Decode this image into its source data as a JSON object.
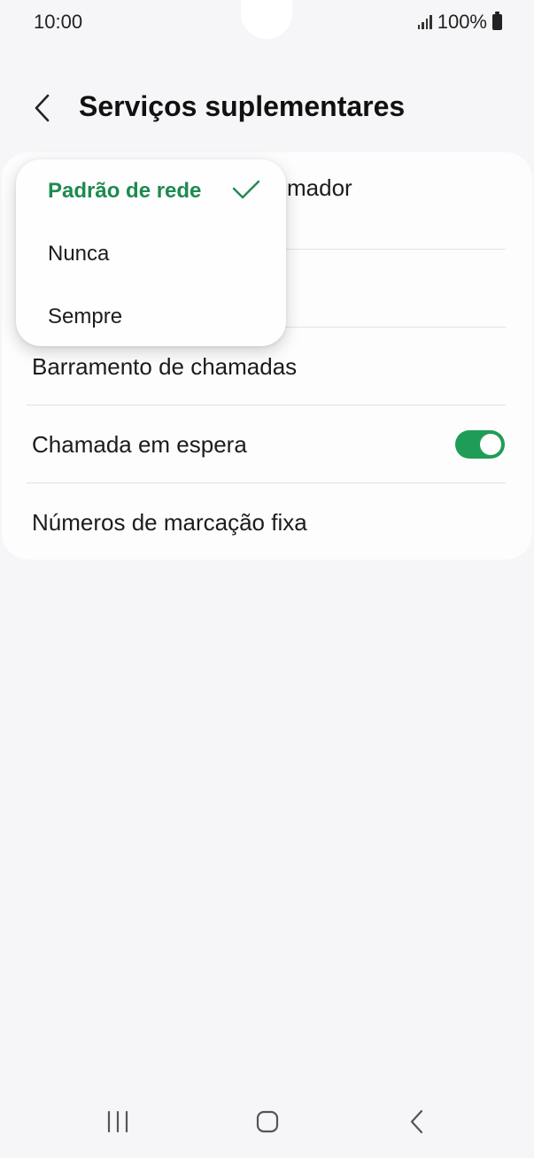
{
  "status_bar": {
    "time": "10:00",
    "battery_percent": "100%",
    "signal_bars": 4
  },
  "app_bar": {
    "title": "Serviços suplementares",
    "back_icon": "chevron-left-icon"
  },
  "settings": {
    "items": [
      {
        "label": "Mostrar ID do chamador"
      },
      {
        "label": ""
      },
      {
        "label": "Barramento de chamadas"
      },
      {
        "label": "Chamada em espera",
        "toggle": true,
        "toggle_on": true
      },
      {
        "label": "Números de marcação fixa"
      }
    ],
    "partial_visible_label": "mador"
  },
  "popup": {
    "options": [
      {
        "label": "Padrão de rede",
        "selected": true
      },
      {
        "label": "Nunca",
        "selected": false
      },
      {
        "label": "Sempre",
        "selected": false
      }
    ],
    "check_icon": "checkmark-icon"
  },
  "nav_bar": {
    "recents_icon": "recents-icon",
    "home_icon": "home-icon",
    "back_icon": "back-icon"
  },
  "colors": {
    "accent": "#1e8a4f",
    "toggle_on": "#1f9d57",
    "background": "#f6f6f8",
    "card": "#fdfdfe"
  }
}
